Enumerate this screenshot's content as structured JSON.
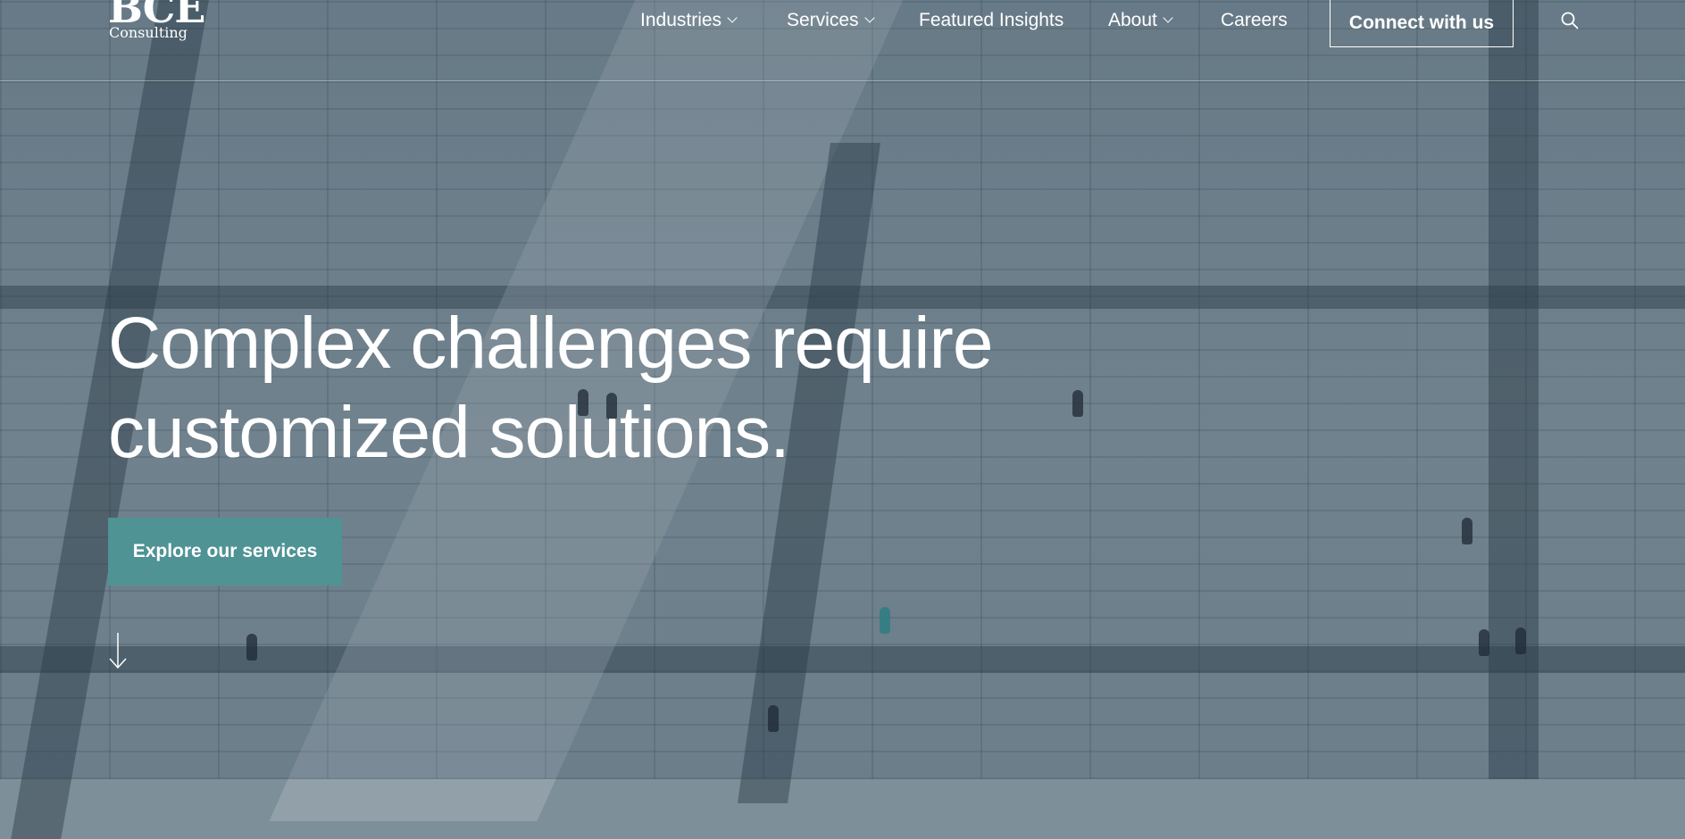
{
  "brand": {
    "logo_text": "BCE",
    "logo_subtext": "Consulting"
  },
  "nav": {
    "items": [
      {
        "label": "Industries",
        "has_dropdown": true
      },
      {
        "label": "Services",
        "has_dropdown": true
      },
      {
        "label": "Featured Insights",
        "has_dropdown": false
      },
      {
        "label": "About",
        "has_dropdown": true
      },
      {
        "label": "Careers",
        "has_dropdown": false
      }
    ],
    "cta_label": "Connect with us",
    "search_icon": "search-icon"
  },
  "hero": {
    "title_line1": "Complex challenges require",
    "title_line2": "customized solutions.",
    "button_label": "Explore our services",
    "scroll_icon": "arrow-down-icon"
  },
  "colors": {
    "accent": "#4f9395",
    "text": "#ffffff"
  }
}
